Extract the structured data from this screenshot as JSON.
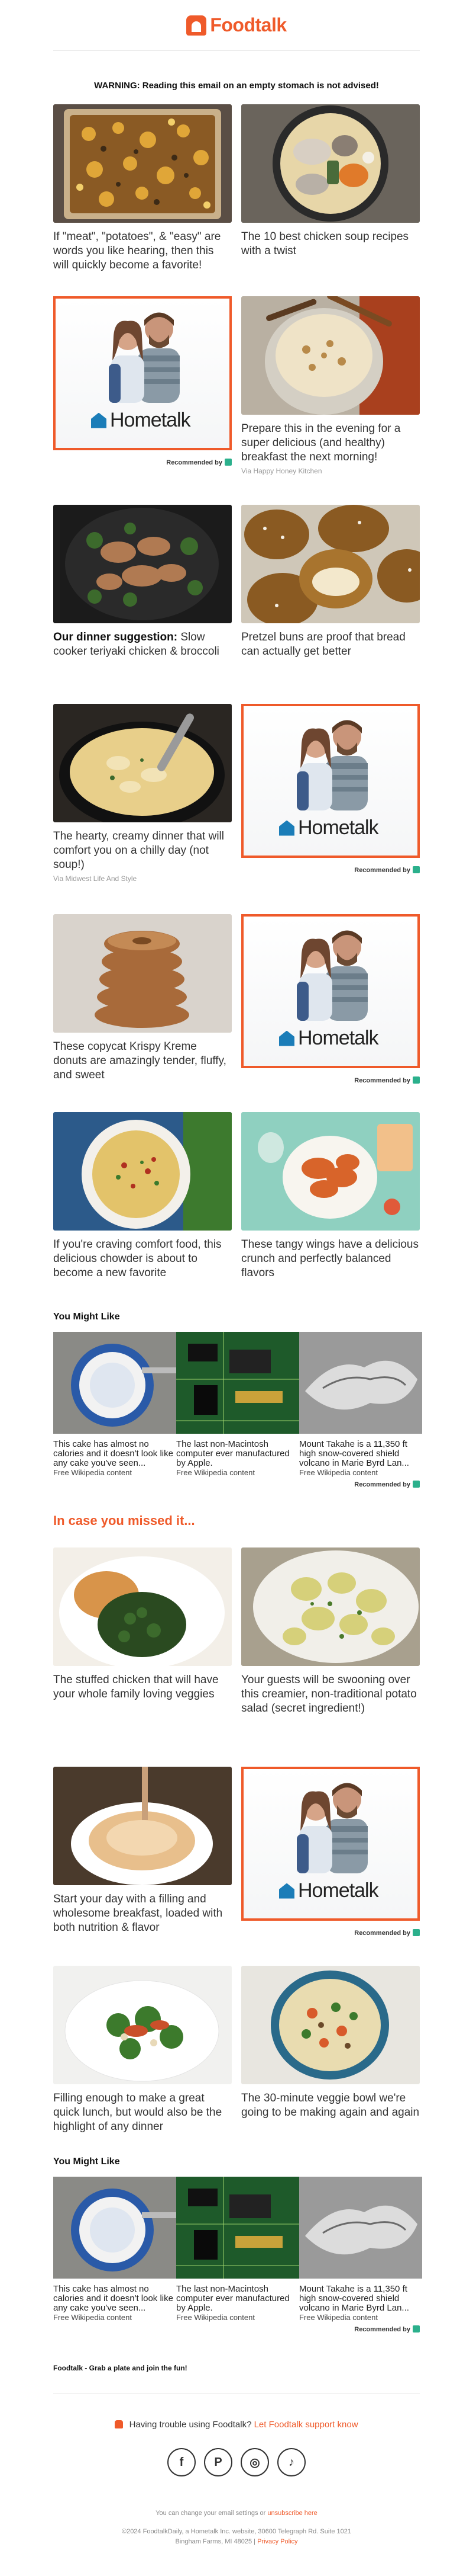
{
  "brand": {
    "name": "Foodtalk",
    "accent": "#ef5a2a"
  },
  "warning": "WARNING: Reading this email on an empty stomach is not advised!",
  "row1": {
    "left": {
      "caption": "If \"meat\", \"potatoes\", & \"easy\" are words you like hearing, then this will quickly become a favorite!",
      "icon": "casserole-photo"
    },
    "right": {
      "caption": "The 10 best chicken soup recipes with a twist",
      "icon": "chicken-soup-photo"
    }
  },
  "row2": {
    "ad": {
      "brand": "Hometalk",
      "recommended": "Recommended by"
    },
    "right": {
      "caption": "Prepare this in the evening for a super delicious (and healthy) breakfast the next morning!",
      "via": "Via Happy Honey Kitchen"
    }
  },
  "row3": {
    "left": {
      "bold": "Our dinner suggestion:",
      "caption": " Slow cooker teriyaki chicken & broccoli"
    },
    "right": {
      "caption": "Pretzel buns are proof that bread can actually get better"
    }
  },
  "row4": {
    "left": {
      "caption": "The hearty, creamy dinner that will comfort you on a chilly day (not soup!)",
      "via": "Via Midwest Life And Style"
    },
    "ad": {
      "brand": "Hometalk",
      "recommended": "Recommended by"
    }
  },
  "row5": {
    "left": {
      "caption": "These copycat Krispy Kreme donuts are amazingly tender, fluffy, and sweet"
    },
    "ad": {
      "brand": "Hometalk",
      "recommended": "Recommended by"
    }
  },
  "row6": {
    "left": {
      "caption": "If you're craving comfort food, this delicious chowder is about to become a new favorite"
    },
    "right": {
      "caption": "These tangy wings have a delicious crunch and perfectly balanced flavors"
    }
  },
  "yml": {
    "title": "You Might Like",
    "items": [
      {
        "text": "This cake has almost no calories and it doesn't look like any cake you've seen...",
        "source": "Free Wikipedia content"
      },
      {
        "text": "The last non-Macintosh computer ever manufactured by Apple.",
        "source": "Free Wikipedia content"
      },
      {
        "text": "Mount Takahe is a 11,350 ft high snow-covered shield volcano in Marie Byrd Lan...",
        "source": "Free Wikipedia content"
      }
    ],
    "recommended": "Recommended by"
  },
  "missed_title": "In case you missed it...",
  "row7": {
    "left": {
      "caption": "The stuffed chicken that will have your whole family loving veggies"
    },
    "right": {
      "caption": "Your guests will be swooning over this creamier, non-traditional potato salad (secret ingredient!)"
    }
  },
  "row8": {
    "left": {
      "caption": "Start your day with a filling and wholesome breakfast, loaded with both nutrition & flavor"
    },
    "ad": {
      "brand": "Hometalk",
      "recommended": "Recommended by"
    }
  },
  "row9": {
    "left": {
      "caption": "Filling enough to make a great quick lunch, but would also be the highlight of any dinner"
    },
    "right": {
      "caption": "The 30-minute veggie bowl we're going to be making again and again"
    }
  },
  "footer": {
    "tagline": "Foodtalk - Grab a plate and join the fun!",
    "trouble_prefix": "Having trouble using Foodtalk?",
    "trouble_link": "Let Foodtalk support know",
    "socials": [
      "f",
      "P",
      "◎",
      "♪"
    ],
    "settings_prefix": "You can change your email settings or",
    "unsubscribe": "unsubscribe here",
    "legal": "©2024 FoodtalkDaily, a Hometalk Inc. website, 30600 Telegraph Rd. Suite 1021",
    "address": "Bingham Farms, MI 48025",
    "privacy": "Privacy Policy"
  }
}
